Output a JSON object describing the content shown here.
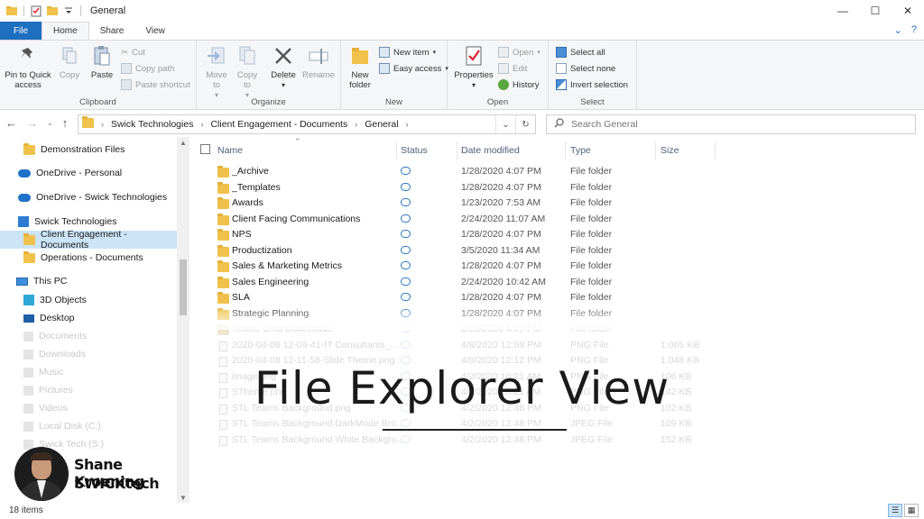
{
  "window": {
    "title": "General",
    "controls": {
      "minimize": "—",
      "maximize": "☐",
      "close": "✕"
    }
  },
  "ribbon_tabs": [
    "File",
    "Home",
    "Share",
    "View"
  ],
  "active_tab": "Home",
  "ribbon": {
    "clipboard": {
      "label": "Clipboard",
      "pin": "Pin to Quick access",
      "copy": "Copy",
      "paste": "Paste",
      "cut": "Cut",
      "copy_path": "Copy path",
      "paste_shortcut": "Paste shortcut"
    },
    "organize": {
      "label": "Organize",
      "move_to": "Move to",
      "copy_to": "Copy to",
      "delete": "Delete",
      "rename": "Rename"
    },
    "new": {
      "label": "New",
      "new_folder": "New folder",
      "new_item": "New item",
      "easy_access": "Easy access"
    },
    "open": {
      "label": "Open",
      "properties": "Properties",
      "open": "Open",
      "edit": "Edit",
      "history": "History"
    },
    "select": {
      "label": "Select",
      "select_all": "Select all",
      "select_none": "Select none",
      "invert": "Invert selection"
    }
  },
  "address": {
    "crumbs": [
      "Swick Technologies",
      "Client Engagement - Documents",
      "General"
    ]
  },
  "search": {
    "placeholder": "Search General"
  },
  "nav_pane": {
    "items": [
      {
        "label": "Demonstration Files",
        "icon": "folder-icon"
      },
      {
        "label": "OneDrive - Personal",
        "icon": "onedrive-icon"
      },
      {
        "label": "OneDrive - Swick Technologies",
        "icon": "onedrive-icon"
      },
      {
        "label": "Swick Technologies",
        "icon": "sharepoint-icon"
      },
      {
        "label": "Client Engagement - Documents",
        "icon": "folder-icon",
        "selected": true
      },
      {
        "label": "Operations - Documents",
        "icon": "folder-icon"
      },
      {
        "label": "This PC",
        "icon": "pc-icon"
      },
      {
        "label": "3D Objects",
        "icon": "3d-objects-icon"
      },
      {
        "label": "Desktop",
        "icon": "desktop-icon"
      },
      {
        "label": "Documents",
        "icon": "documents-icon",
        "faded": true
      },
      {
        "label": "Downloads",
        "icon": "downloads-icon",
        "faded": true
      },
      {
        "label": "Music",
        "icon": "music-icon",
        "faded": true
      },
      {
        "label": "Pictures",
        "icon": "pictures-icon",
        "faded": true
      },
      {
        "label": "Videos",
        "icon": "videos-icon",
        "faded": true
      },
      {
        "label": "Local Disk (C:)",
        "icon": "disk-icon",
        "faded": true
      },
      {
        "label": "Swick Tech (S:)",
        "icon": "disk-icon",
        "faded": true
      }
    ]
  },
  "columns": {
    "name": "Name",
    "status": "Status",
    "date": "Date modified",
    "type": "Type",
    "size": "Size"
  },
  "files": [
    {
      "name": "_Archive",
      "date": "1/28/2020 4:07 PM",
      "type": "File folder",
      "size": ""
    },
    {
      "name": "_Templates",
      "date": "1/28/2020 4:07 PM",
      "type": "File folder",
      "size": ""
    },
    {
      "name": "Awards",
      "date": "1/23/2020 7:53 AM",
      "type": "File folder",
      "size": ""
    },
    {
      "name": "Client Facing Communications",
      "date": "2/24/2020 11:07 AM",
      "type": "File folder",
      "size": ""
    },
    {
      "name": "NPS",
      "date": "1/28/2020 4:07 PM",
      "type": "File folder",
      "size": ""
    },
    {
      "name": "Productization",
      "date": "3/5/2020 11:34 AM",
      "type": "File folder",
      "size": ""
    },
    {
      "name": "Sales & Marketing Metrics",
      "date": "1/28/2020 4:07 PM",
      "type": "File folder",
      "size": ""
    },
    {
      "name": "Sales Engineering",
      "date": "2/24/2020 10:42 AM",
      "type": "File folder",
      "size": ""
    },
    {
      "name": "SLA",
      "date": "1/28/2020 4:07 PM",
      "type": "File folder",
      "size": ""
    },
    {
      "name": "Strategic Planning",
      "date": "1/28/2020 4:07 PM",
      "type": "File folder",
      "size": ""
    },
    {
      "name": "Teams Chat Downloads",
      "date": "1/28/2020 4:07 PM",
      "type": "File folder",
      "size": "",
      "faded": true
    },
    {
      "name": "2020-04-08 12-09-41-IT Consultants_...",
      "date": "4/8/2020 12:09 PM",
      "type": "PNG File",
      "size": "1,065 KB",
      "faded": true
    },
    {
      "name": "2020-04-08 12-11-58-Slide Theme.png",
      "date": "4/8/2020 12:12 PM",
      "type": "PNG File",
      "size": "1,048 KB",
      "faded": true
    },
    {
      "name": "image.png",
      "date": "4/2/2020 10:21 AM",
      "type": "PNG File",
      "size": "106 KB",
      "faded": true
    },
    {
      "name": "STheme.png",
      "date": "4/2/2020 10:21 AM",
      "type": "PNG File",
      "size": "142 KB",
      "faded": true
    },
    {
      "name": "STL Teams Background.png",
      "date": "4/2/2020 12:48 PM",
      "type": "PNG File",
      "size": "102 KB",
      "faded": true
    },
    {
      "name": "STL Teams Background DarkMode Bro...",
      "date": "4/2/2020 12:48 PM",
      "type": "JPEG File",
      "size": "109 KB",
      "faded": true
    },
    {
      "name": "STL Teams Background White Backgro...",
      "date": "4/2/2020 12:48 PM",
      "type": "JPEG File",
      "size": "152 KB",
      "faded": true
    }
  ],
  "status_bar": {
    "count": "18 items"
  },
  "overlay": {
    "title": "File Explorer View"
  },
  "presenter": {
    "name": "Shane Kroening",
    "company": "SWICKtech"
  }
}
